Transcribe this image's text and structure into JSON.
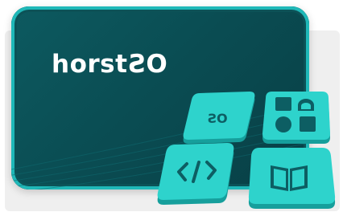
{
  "logo": {
    "prefix": "horst",
    "mirrored": "OS",
    "suffix": ""
  },
  "tiles": {
    "os_label": "OS"
  },
  "colors": {
    "card_dark": "#0a4d53",
    "card_border": "#1fb8b8",
    "tile": "#2ed3cc",
    "tile_dark": "#169f9c",
    "tile_glyph": "#0d5e63"
  },
  "icons": [
    "os-logo-icon",
    "shapes-icon",
    "code-icon",
    "book-icon"
  ]
}
